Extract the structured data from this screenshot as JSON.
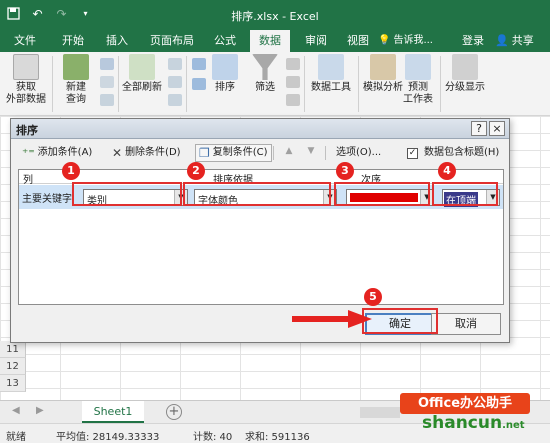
{
  "window": {
    "title": "排序.xlsx - Excel"
  },
  "ribbon_tabs": [
    "文件",
    "开始",
    "插入",
    "页面布局",
    "公式",
    "数据",
    "审阅",
    "视图"
  ],
  "active_tab": "数据",
  "tell_me": "告诉我...",
  "login": "登录",
  "share": "共享",
  "ribbon": {
    "get_external": [
      "获取",
      "外部数据"
    ],
    "new_query": [
      "新建",
      "查询"
    ],
    "refresh_all": "全部刷新",
    "sort": "排序",
    "filter": "筛选",
    "data_tools": "数据工具",
    "what_if": "模拟分析",
    "forecast": [
      "预测",
      "工作表"
    ],
    "outline": "分级显示"
  },
  "dialog": {
    "title": "排序",
    "help": "?",
    "close": "×",
    "add_level": "添加条件(A)",
    "delete_level": "删除条件(D)",
    "copy_level": "复制条件(C)",
    "options": "选项(O)...",
    "has_headers": "数据包含标题(H)",
    "has_headers_checked": true,
    "col_header": "列",
    "sort_on_header": "排序依据",
    "order_header": "次序",
    "row_label": "主要关键字",
    "column_value": "类别",
    "sort_on_value": "字体颜色",
    "order_color": "#e00000",
    "position_value": "在顶端",
    "ok": "确定",
    "cancel": "取消"
  },
  "badges": [
    "1",
    "2",
    "3",
    "4",
    "5"
  ],
  "row_numbers": [
    "11",
    "12",
    "13"
  ],
  "sheet_tab": "Sheet1",
  "status": {
    "mode": "就绪",
    "average": "平均值: 28149.33333",
    "count": "计数: 40",
    "sum": "求和: 591136"
  },
  "watermark": {
    "top": "Office办公助手",
    "bottom": "shancun",
    "bottom_suffix": ".net"
  },
  "colors": {
    "excel_green": "#217346",
    "badge_red": "#e52320",
    "highlight_red": "#e03030"
  }
}
